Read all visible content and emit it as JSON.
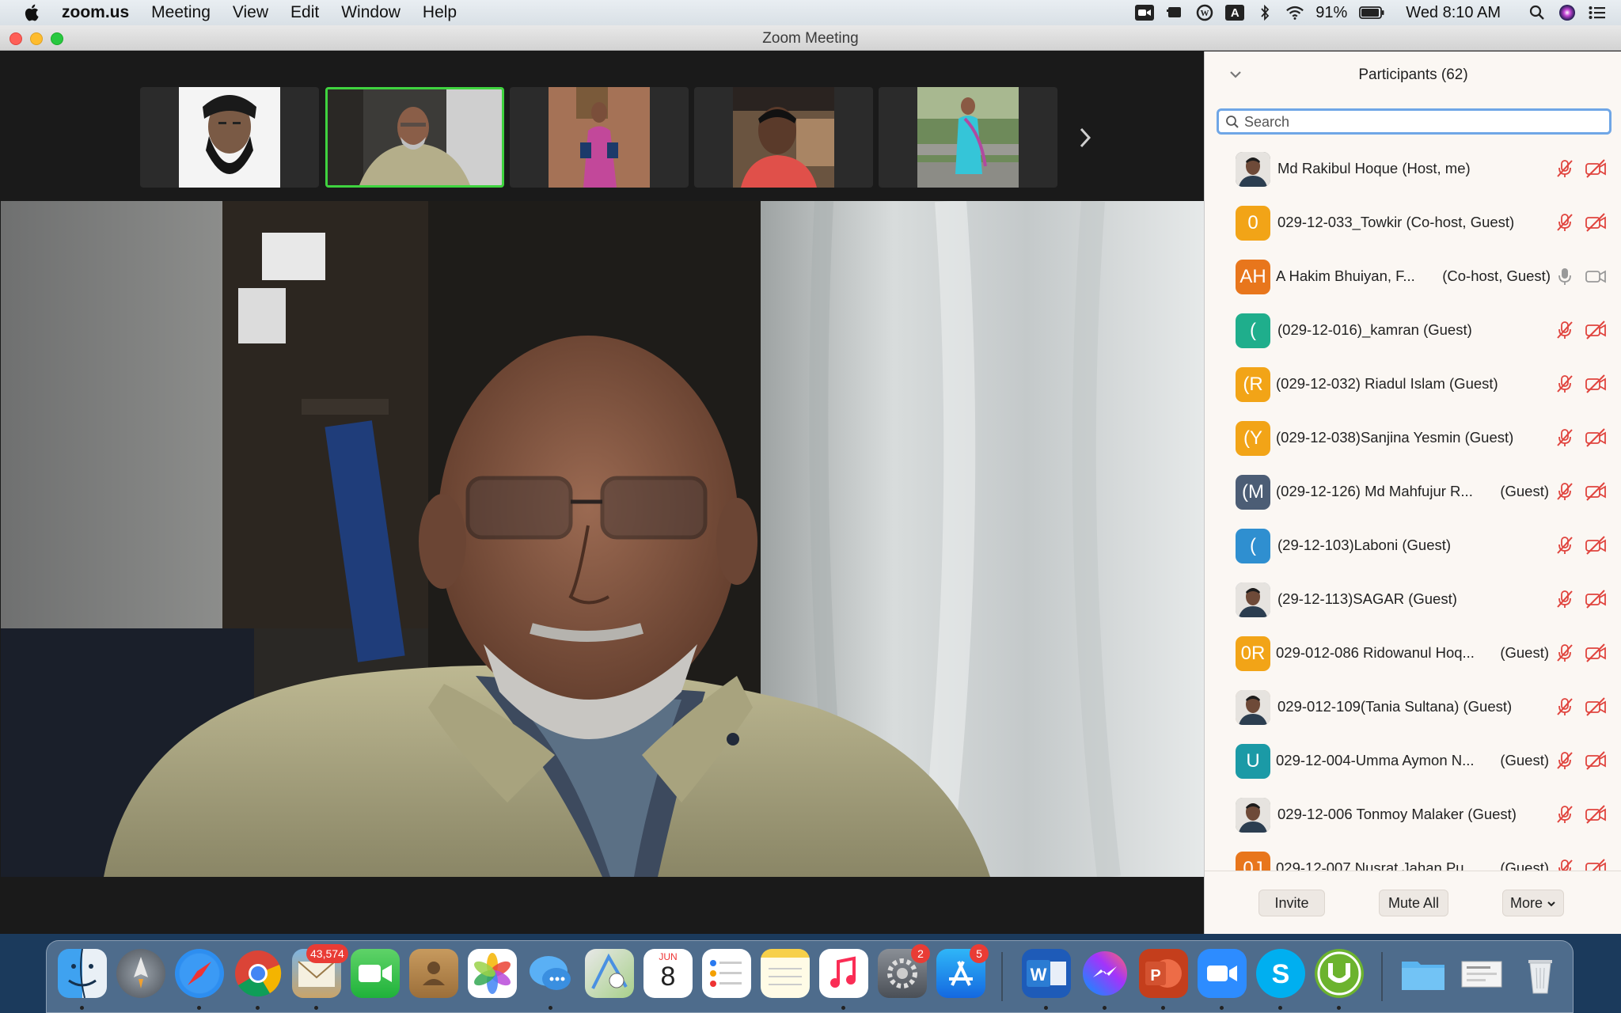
{
  "menubar": {
    "app_name": "zoom.us",
    "menus": [
      "Meeting",
      "View",
      "Edit",
      "Window",
      "Help"
    ],
    "battery": "91%",
    "clock": "Wed 8:10 AM",
    "tray_a_label": "A"
  },
  "window": {
    "title": "Zoom Meeting"
  },
  "participants_panel": {
    "title": "Participants (62)",
    "search_placeholder": "Search",
    "participants": [
      {
        "name": "Md Rakibul Hoque (Host, me)",
        "role": "",
        "initials": "",
        "avatar_color": "#4a4a4a",
        "photo": true,
        "mic": "muted",
        "video": "off"
      },
      {
        "name": "029-12-033_Towkir (Co-host, Guest)",
        "role": "",
        "initials": "0",
        "avatar_color": "#f2a417",
        "photo": false,
        "mic": "muted",
        "video": "off"
      },
      {
        "name": "A Hakim Bhuiyan, F...",
        "role": "(Co-host, Guest)",
        "initials": "AH",
        "avatar_color": "#e8761c",
        "photo": false,
        "mic": "on",
        "video": "on"
      },
      {
        "name": "(029-12-016)_kamran (Guest)",
        "role": "",
        "initials": "(",
        "avatar_color": "#1fae8c",
        "photo": false,
        "mic": "muted",
        "video": "off"
      },
      {
        "name": "(029-12-032) Riadul Islam (Guest)",
        "role": "",
        "initials": "(R",
        "avatar_color": "#f2a417",
        "photo": false,
        "mic": "muted",
        "video": "off"
      },
      {
        "name": "(029-12-038)Sanjina Yesmin (Guest)",
        "role": "",
        "initials": "(Y",
        "avatar_color": "#f2a417",
        "photo": false,
        "mic": "muted",
        "video": "off"
      },
      {
        "name": "(029-12-126) Md Mahfujur R...",
        "role": "(Guest)",
        "initials": "(M",
        "avatar_color": "#4c5d75",
        "photo": false,
        "mic": "muted",
        "video": "off"
      },
      {
        "name": "(29-12-103)Laboni (Guest)",
        "role": "",
        "initials": "(",
        "avatar_color": "#2f8fd0",
        "photo": false,
        "mic": "muted",
        "video": "off"
      },
      {
        "name": "(29-12-113)SAGAR (Guest)",
        "role": "",
        "initials": "",
        "avatar_color": "#8899aa",
        "photo": true,
        "mic": "muted",
        "video": "off"
      },
      {
        "name": "029-012-086 Ridowanul Hoq...",
        "role": "(Guest)",
        "initials": "0R",
        "avatar_color": "#f2a417",
        "photo": false,
        "mic": "muted",
        "video": "off"
      },
      {
        "name": "029-012-109(Tania Sultana) (Guest)",
        "role": "",
        "initials": "",
        "avatar_color": "#c9a48a",
        "photo": true,
        "mic": "muted",
        "video": "off"
      },
      {
        "name": "029-12-004-Umma Aymon N...",
        "role": "(Guest)",
        "initials": "U",
        "avatar_color": "#1b9aa6",
        "photo": false,
        "mic": "muted",
        "video": "off"
      },
      {
        "name": "029-12-006 Tonmoy Malaker (Guest)",
        "role": "",
        "initials": "",
        "avatar_color": "#7a8a70",
        "photo": true,
        "mic": "muted",
        "video": "off"
      },
      {
        "name": "029-12-007 Nusrat Jahan Pu...",
        "role": "(Guest)",
        "initials": "0J",
        "avatar_color": "#e8761c",
        "photo": false,
        "mic": "muted",
        "video": "off"
      }
    ],
    "footer": {
      "invite": "Invite",
      "mute_all": "Mute All",
      "more": "More"
    }
  },
  "dock": {
    "badges": {
      "mail": "43,574",
      "system_preferences": "2",
      "app_store": "5"
    },
    "calendar": {
      "month": "JUN",
      "day": "8"
    }
  },
  "colors": {
    "active_speaker_border": "#3fd33f",
    "muted_red": "#e0443e",
    "search_focus": "#6fa6e6"
  }
}
